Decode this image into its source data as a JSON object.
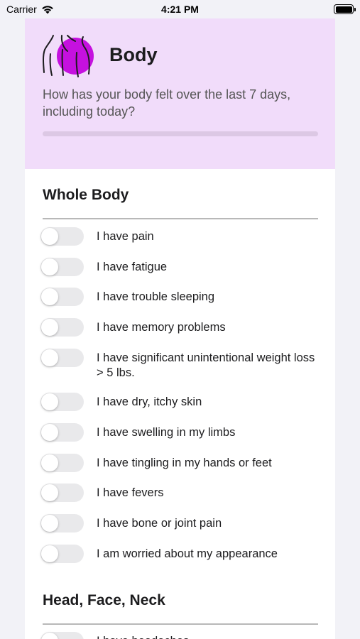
{
  "status_bar": {
    "carrier": "Carrier",
    "time": "4:21 PM",
    "battery_level": 1.0
  },
  "header": {
    "title": "Body",
    "question": "How has your body felt over the last 7 days, including today?",
    "icon": "body-shoulders-icon",
    "accent_color": "#c511df",
    "background_color": "#f1dcfa",
    "progress": 0.0
  },
  "sections": [
    {
      "title": "Whole Body",
      "items": [
        {
          "label": "I have pain",
          "checked": false
        },
        {
          "label": "I have fatigue",
          "checked": false
        },
        {
          "label": "I have trouble sleeping",
          "checked": false
        },
        {
          "label": "I have memory problems",
          "checked": false
        },
        {
          "label": "I have significant unintentional weight loss > 5 lbs.",
          "checked": false
        },
        {
          "label": "I have dry, itchy skin",
          "checked": false
        },
        {
          "label": "I have swelling in my limbs",
          "checked": false
        },
        {
          "label": "I have tingling in my hands or feet",
          "checked": false
        },
        {
          "label": "I have fevers",
          "checked": false
        },
        {
          "label": "I have bone or joint pain",
          "checked": false
        },
        {
          "label": "I am worried about my appearance",
          "checked": false
        }
      ]
    },
    {
      "title": "Head, Face, Neck",
      "items": [
        {
          "label": "I have headaches",
          "checked": false
        }
      ]
    }
  ]
}
